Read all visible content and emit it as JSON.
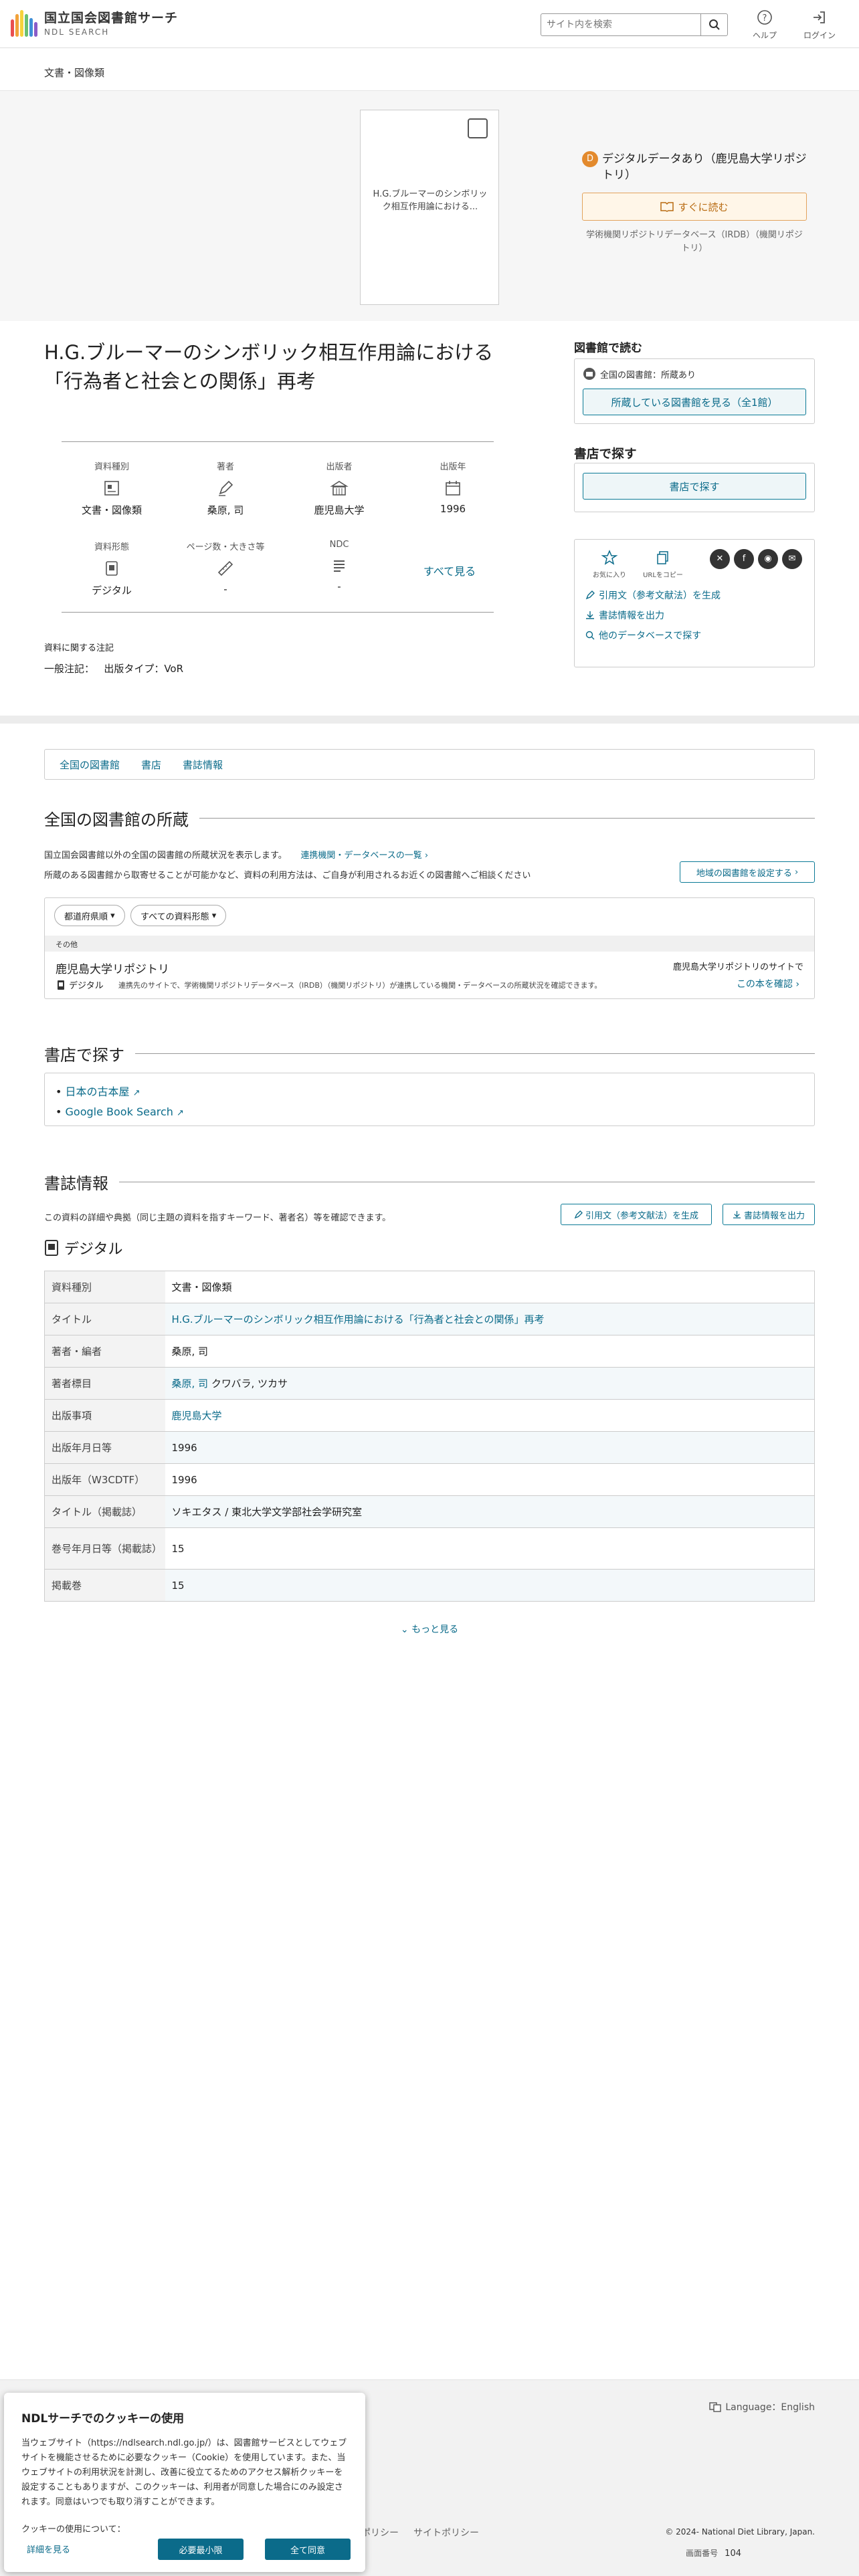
{
  "header": {
    "logo_title": "国立国会図書館サーチ",
    "logo_sub": "NDL SEARCH",
    "search_placeholder": "サイト内を検索",
    "help": "ヘルプ",
    "login": "ログイン"
  },
  "breadcrumb": "文書・図像類",
  "thumbnail_text": "H.G.ブルーマーのシンボリック相互作用論における...",
  "availability": {
    "badge": "D",
    "title": "デジタルデータあり（鹿児島大学リポジトリ）",
    "read_button": "すぐに読む",
    "source": "学術機関リポジトリデータベース（IRDB）（機関リポジトリ）"
  },
  "title": "H.G.ブルーマーのシンボリック相互作用論における「行為者と社会との関係」再考",
  "meta": [
    {
      "label": "資料種別",
      "value": "文書・図像類",
      "icon": "document-type-icon"
    },
    {
      "label": "著者",
      "value": "桑原, 司",
      "icon": "pen-icon"
    },
    {
      "label": "出版者",
      "value": "鹿児島大学",
      "icon": "building-icon"
    },
    {
      "label": "出版年",
      "value": "1996",
      "icon": "calendar-icon"
    },
    {
      "label": "資料形態",
      "value": "デジタル",
      "icon": "digital-icon"
    },
    {
      "label": "ページ数・大きさ等",
      "value": "-",
      "icon": "ruler-icon"
    },
    {
      "label": "NDC",
      "value": "-",
      "icon": "list-icon"
    }
  ],
  "see_all": "すべて見る",
  "notes": {
    "heading": "資料に関する注記",
    "key": "一般注記：",
    "value": "出版タイプ：VoR"
  },
  "right": {
    "library_heading": "図書館で読む",
    "library_status": "全国の図書館：所蔵あり",
    "library_button": "所蔵している図書館を見る（全1館）",
    "shop_heading": "書店で探す",
    "shop_button": "書店で探す",
    "fav": "お気に入り",
    "copy_url": "URLをコピー",
    "cite": "引用文（参考文献法）を生成",
    "export": "書誌情報を出力",
    "other_db": "他のデータベースで探す"
  },
  "tabs": [
    "全国の図書館",
    "書店",
    "書誌情報"
  ],
  "holdings": {
    "heading": "全国の図書館の所蔵",
    "desc1": "国立国会図書館以外の全国の図書館の所蔵状況を表示します。",
    "desc_link": "連携機関・データベースの一覧",
    "desc2": "所蔵のある図書館から取寄せることが可能かなど、資料の利用方法は、ご自身が利用されるお近くの図書館へご相談ください",
    "region_button": "地域の図書館を設定する",
    "filter_pref": "都道府県順",
    "filter_type": "すべての資料形態",
    "group": "その他",
    "library": "鹿児島大学リポジトリ",
    "library_right": "鹿児島大学リポジトリのサイトで",
    "digital": "デジタル",
    "note": "連携先のサイトで、学術機関リポジトリデータベース（IRDB）（機関リポジトリ）が連携している機関・データベースの所蔵状況を確認できます。",
    "check": "この本を確認"
  },
  "shops": {
    "heading": "書店で探す",
    "items": [
      "日本の古本屋",
      "Google Book Search"
    ]
  },
  "bib": {
    "heading": "書誌情報",
    "desc": "この資料の詳細や典拠（同じ主題の資料を指すキーワード、著者名）等を確認できます。",
    "cite": "引用文（参考文献法）を生成",
    "export": "書誌情報を出力",
    "format": "デジタル",
    "rows": [
      {
        "k": "資料種別",
        "v": "文書・図像類"
      },
      {
        "k": "タイトル",
        "v": "H.G.ブルーマーのシンボリック相互作用論における「行為者と社会との関係」再考"
      },
      {
        "k": "著者・編者",
        "v": "桑原, 司"
      },
      {
        "k": "著者標目",
        "v": "桑原, 司",
        "extra": " クワバラ, ツカサ"
      },
      {
        "k": "出版事項",
        "v": "鹿児島大学"
      },
      {
        "k": "出版年月日等",
        "v": "1996"
      },
      {
        "k": "出版年（W3CDTF）",
        "v": "1996"
      },
      {
        "k": "タイトル（掲載誌）",
        "v": "ソキエタス / 東北大学文学部社会学研究室"
      },
      {
        "k": "巻号年月日等（掲載誌）",
        "v": "15"
      },
      {
        "k": "掲載巻",
        "v": "15"
      }
    ],
    "more": "もっと見る"
  },
  "footer": {
    "lang": "Language：English",
    "links": [
      "ポリシー",
      "サイトポリシー"
    ],
    "copyright": "© 2024- National Diet Library, Japan.",
    "server_label": "画面番号",
    "server_no": "104"
  },
  "cookie": {
    "title": "NDLサーチでのクッキーの使用",
    "body": "当ウェブサイト（https://ndlsearch.ndl.go.jp/）は、図書館サービスとしてウェブサイトを機能させるために必要なクッキー（Cookie）を使用しています。また、当ウェブサイトの利用状況を計測し、改善に役立てるためのアクセス解析クッキーを設定することもありますが、このクッキーは、利用者が同意した場合にのみ設定されます。同意はいつでも取り消すことができます。",
    "use": "クッキーの使用について：",
    "details": "詳細を見る",
    "minimal": "必要最小限",
    "accept": "全て同意"
  },
  "colors": {
    "accent": "#0b6b8a",
    "orange": "#e38a2d"
  }
}
